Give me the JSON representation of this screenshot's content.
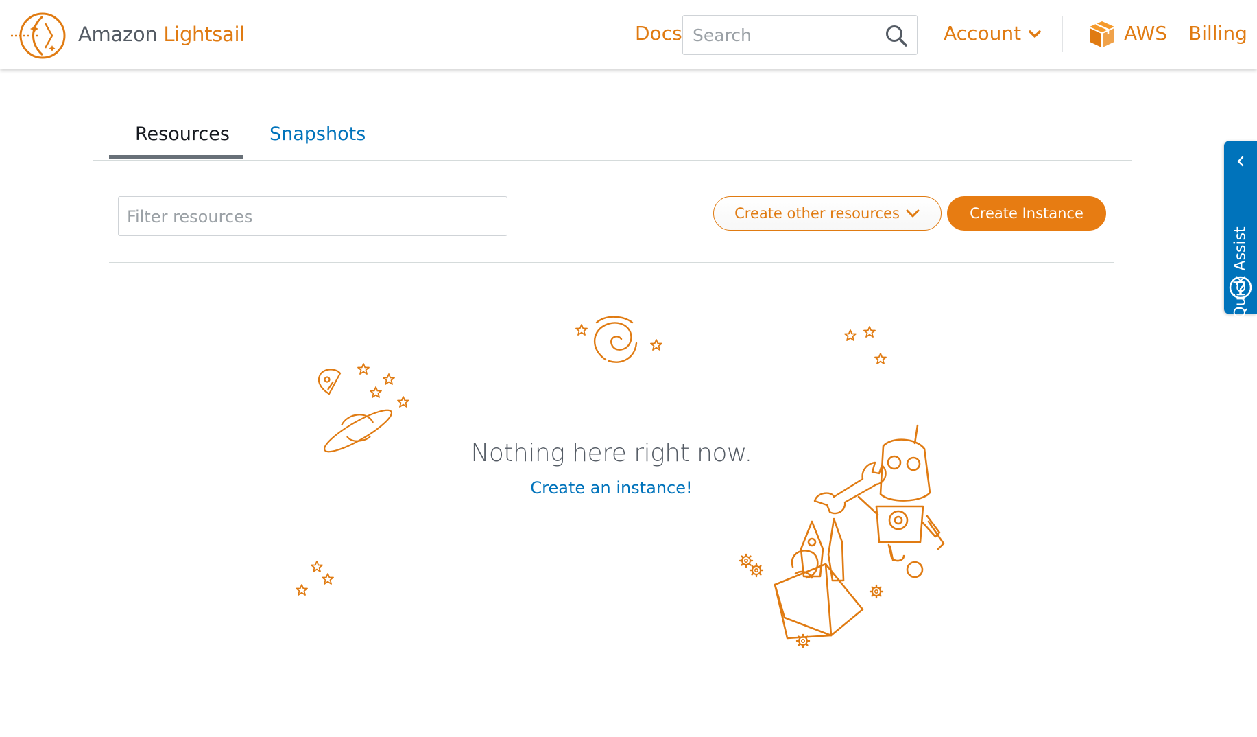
{
  "header": {
    "brand_prefix": "Amazon ",
    "brand_accent": "Lightsail",
    "docs_label": "Docs",
    "search_placeholder": "Search",
    "account_label": "Account",
    "aws_label": "AWS",
    "billing_label": "Billing"
  },
  "tabs": [
    {
      "label": "Resources",
      "active": true
    },
    {
      "label": "Snapshots",
      "active": false
    }
  ],
  "toolbar": {
    "filter_placeholder": "Filter resources",
    "create_other_label": "Create other resources",
    "create_instance_label": "Create Instance"
  },
  "empty_state": {
    "title": "Nothing here right now.",
    "link": "Create an instance!"
  },
  "quick_assist": {
    "label": "Quick Assist"
  },
  "icons": {
    "logo": "lightsail-logo-icon",
    "search": "search-icon",
    "account_dropdown": "chevron-down-icon",
    "aws": "aws-box-icon",
    "create_other_dropdown": "chevron-down-icon",
    "quick_assist_collapse": "chevron-left-icon",
    "quick_assist_help": "question-circle-icon"
  },
  "colors": {
    "accent": "#e07b12",
    "button_primary": "#e77c12",
    "link": "#0073bb",
    "text": "#545b64",
    "quick_assist_bg": "#0073bb"
  }
}
